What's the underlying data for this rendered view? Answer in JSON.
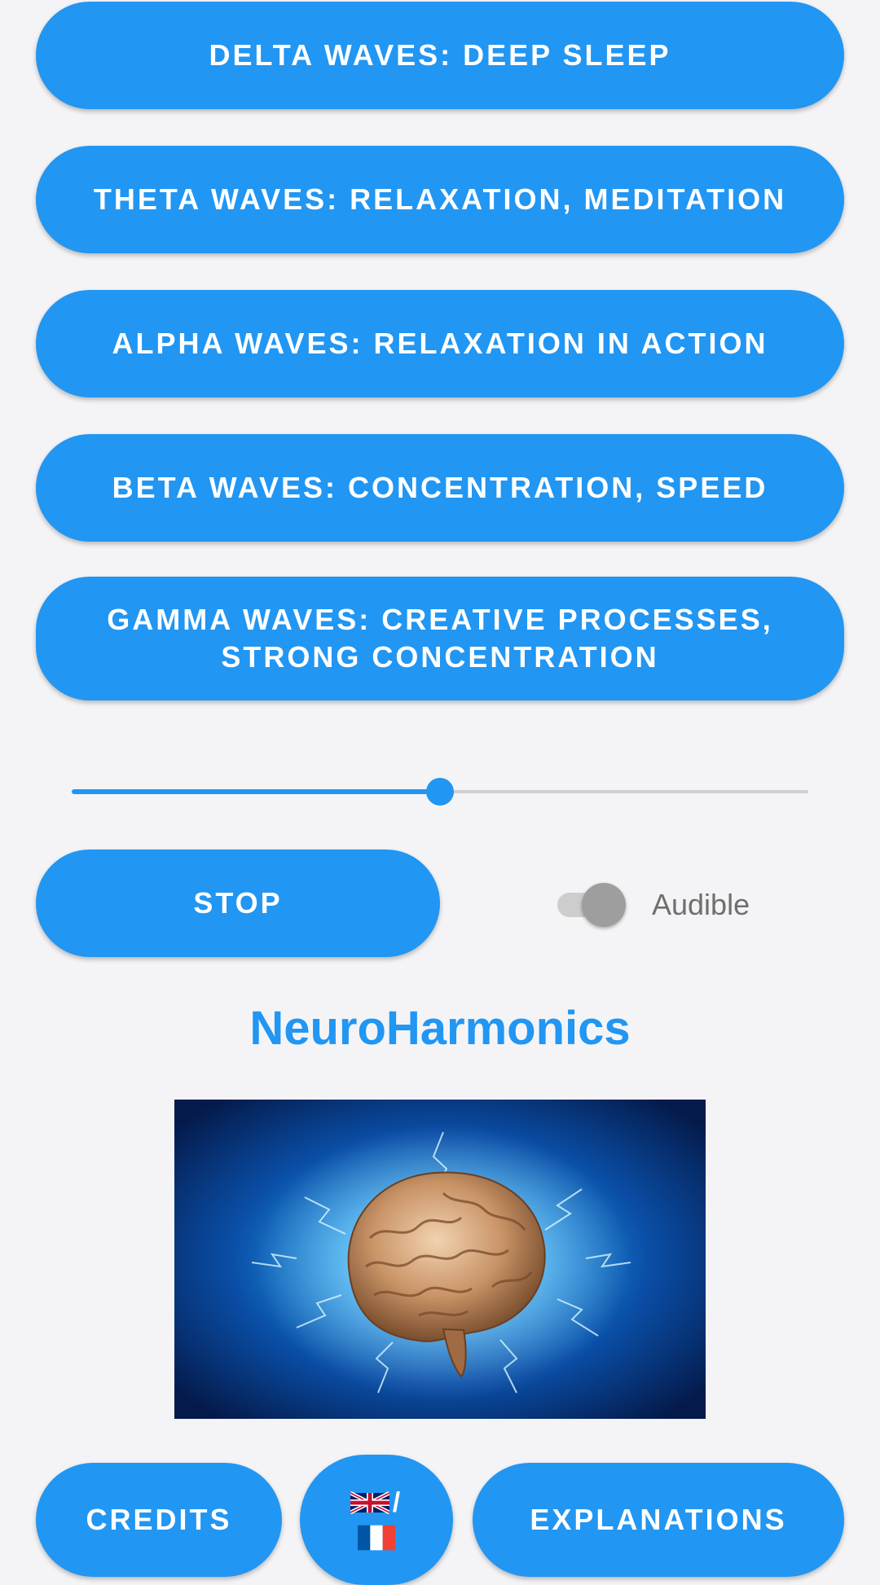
{
  "wave_buttons": {
    "delta": "DELTA WAVES: DEEP SLEEP",
    "theta": "THETA WAVES: RELAXATION, MEDITATION",
    "alpha": "ALPHA WAVES: RELAXATION IN ACTION",
    "beta": "BETA WAVES: CONCENTRATION, SPEED",
    "gamma_line1": "GAMMA WAVES: CREATIVE PROCESSES,",
    "gamma_line2": "STRONG CONCENTRATION"
  },
  "volume_slider": {
    "value_fraction": 0.5
  },
  "controls": {
    "stop_label": "STOP",
    "audible_label": "Audible",
    "audible_on": false
  },
  "app": {
    "title": "NeuroHarmonics"
  },
  "bottom_bar": {
    "credits_label": "CREDITS",
    "language_separator": "/",
    "language_icons": [
      "uk-flag-icon",
      "france-flag-icon"
    ],
    "explanations_label": "EXPLANATIONS"
  },
  "colors": {
    "accent": "#2196f3",
    "background": "#f4f4f6",
    "switch_off_knob": "#9e9e9e"
  }
}
